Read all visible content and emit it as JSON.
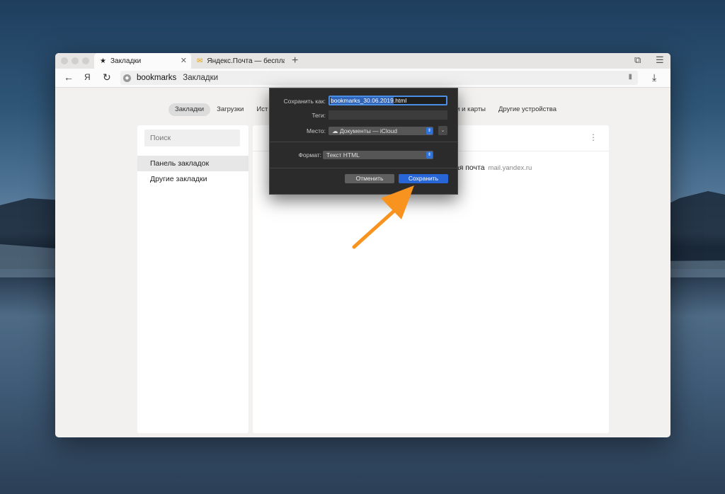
{
  "browser": {
    "tabs": [
      {
        "icon": "star-icon",
        "label": "Закладки"
      },
      {
        "icon": "yandex-mail-icon",
        "label": "Яндекс.Почта — бесплат"
      }
    ],
    "nav": {
      "back": "←",
      "yandex": "Я",
      "reload": "↻"
    },
    "address": {
      "host": "bookmarks",
      "title": "Закладки"
    }
  },
  "subnav": {
    "items": [
      "Закладки",
      "Загрузки",
      "Ист",
      "роли и карты",
      "Другие устройства"
    ],
    "selected": "Закладки"
  },
  "sidebar": {
    "search_placeholder": "Поиск",
    "folders": [
      "Панель закладок",
      "Другие закладки"
    ]
  },
  "bookmarks": [
    {
      "title": "ная почта",
      "host": "mail.yandex.ru"
    }
  ],
  "save_dialog": {
    "save_as_label": "Сохранить как:",
    "filename_base": "bookmarks_30.06.2019",
    "filename_ext": ".html",
    "tags_label": "Теги:",
    "location_label": "Место:",
    "location_value": "Документы — iCloud",
    "format_label": "Формат:",
    "format_value": "Текст HTML",
    "cancel_label": "Отменить",
    "save_label": "Сохранить"
  },
  "colors": {
    "accent": "#2866d8",
    "annotation_arrow": "#f7931e"
  }
}
